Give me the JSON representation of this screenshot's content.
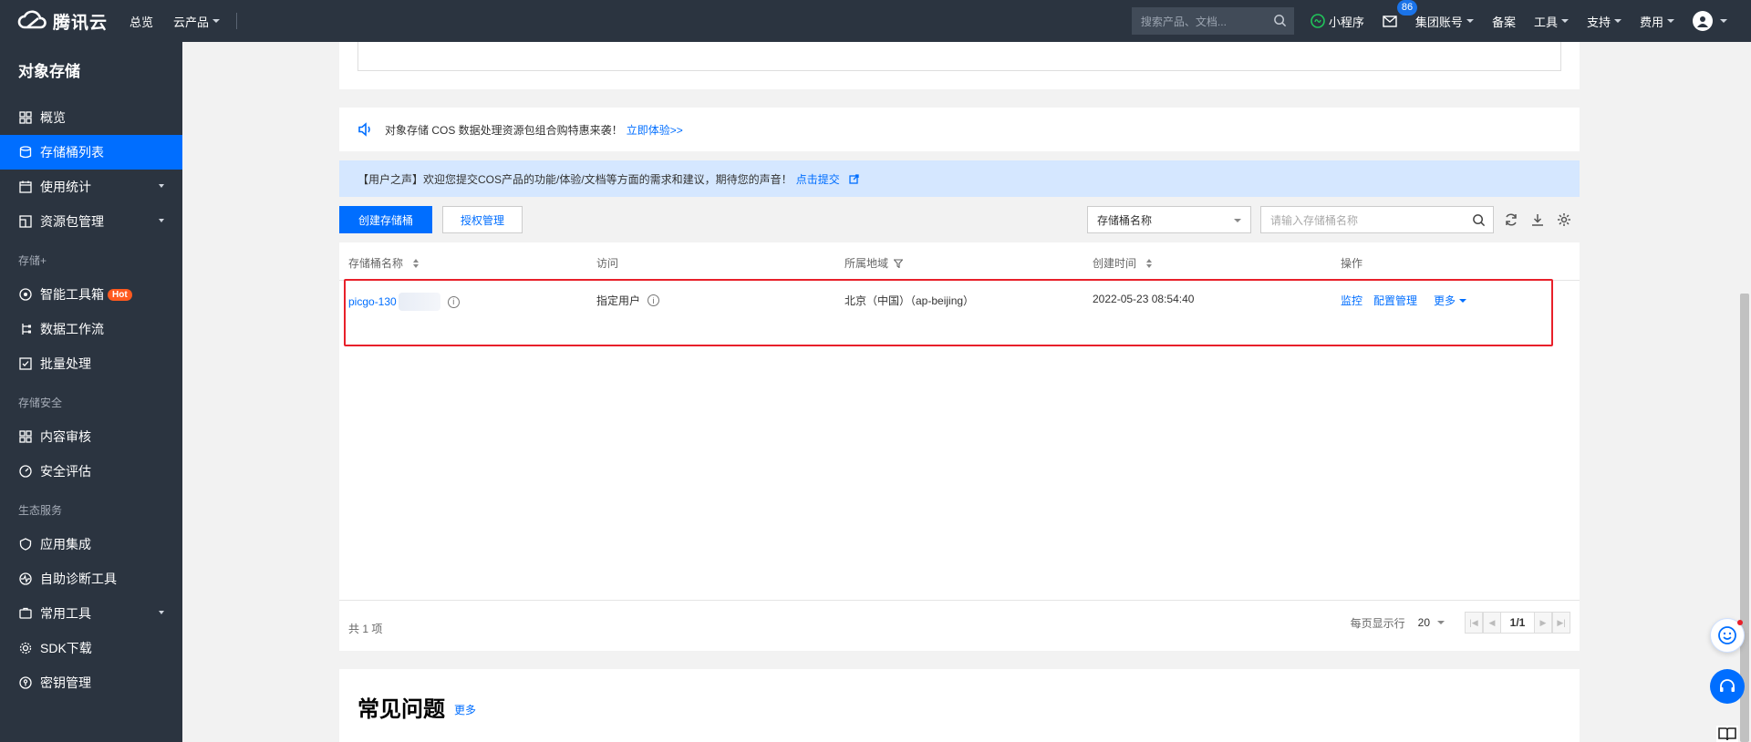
{
  "topbar": {
    "brand": "腾讯云",
    "nav": [
      "总览",
      "云产品"
    ],
    "search_placeholder": "搜索产品、文档...",
    "miniprogram": "小程序",
    "mail_badge": "86",
    "account": "集团账号",
    "beian": "备案",
    "tools": "工具",
    "support": "支持",
    "billing": "费用"
  },
  "sidebar": {
    "title": "对象存储",
    "items": [
      {
        "label": "概览",
        "icon": "grid-icon"
      },
      {
        "label": "存储桶列表",
        "icon": "bucket-icon",
        "active": true
      },
      {
        "label": "使用统计",
        "icon": "calendar-icon",
        "expand": true
      },
      {
        "label": "资源包管理",
        "icon": "package-icon",
        "expand": true
      }
    ],
    "group1": "存储+",
    "group1_items": [
      {
        "label": "智能工具箱",
        "icon": "ai-icon",
        "badge": "Hot"
      },
      {
        "label": "数据工作流",
        "icon": "flow-icon"
      },
      {
        "label": "批量处理",
        "icon": "check-box-icon"
      }
    ],
    "group2": "存储安全",
    "group2_items": [
      {
        "label": "内容审核",
        "icon": "grid-icon"
      },
      {
        "label": "安全评估",
        "icon": "gauge-icon"
      }
    ],
    "group3": "生态服务",
    "group3_items": [
      {
        "label": "应用集成",
        "icon": "shield-icon"
      },
      {
        "label": "自助诊断工具",
        "icon": "pulse-icon"
      },
      {
        "label": "常用工具",
        "icon": "wrench-icon",
        "expand": true
      },
      {
        "label": "SDK下载",
        "icon": "gear-icon"
      },
      {
        "label": "密钥管理",
        "icon": "key-icon"
      }
    ]
  },
  "notice": {
    "text": "对象存储 COS 数据处理资源包组合购特惠来袭！",
    "link": "立即体验>>"
  },
  "voice": {
    "text": "【用户之声】欢迎您提交COS产品的功能/体验/文档等方面的需求和建议，期待您的声音！",
    "link": "点击提交"
  },
  "toolbar": {
    "create_label": "创建存储桶",
    "auth_label": "授权管理",
    "select_value": "存储桶名称",
    "search_placeholder": "请输入存储桶名称"
  },
  "table": {
    "headers": [
      "存储桶名称",
      "访问",
      "所属地域",
      "创建时间",
      "操作"
    ],
    "rows": [
      {
        "name": "picgo-130",
        "access": "指定用户",
        "region": "北京（中国）（ap-beijing）",
        "created": "2022-05-23 08:54:40",
        "actions": [
          "监控",
          "配置管理",
          "更多"
        ]
      }
    ],
    "total": "共 1 项",
    "page_size_label": "每页显示行",
    "page_size": "20",
    "page": "1/1"
  },
  "faq": {
    "title": "常见问题",
    "more": "更多"
  },
  "colors": {
    "primary": "#006eff",
    "sidebar_bg": "#2b3440",
    "highlight": "#e8202a"
  }
}
